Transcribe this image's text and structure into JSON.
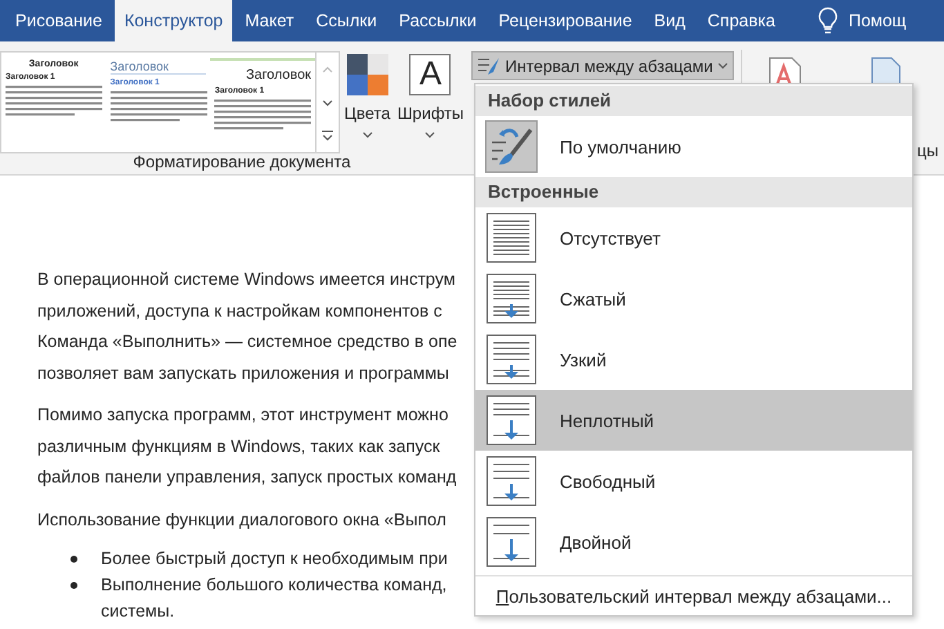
{
  "tabs": [
    {
      "label": "Рисование",
      "selected": false
    },
    {
      "label": "Конструктор",
      "selected": true
    },
    {
      "label": "Макет",
      "selected": false
    },
    {
      "label": "Ссылки",
      "selected": false
    },
    {
      "label": "Рассылки",
      "selected": false
    },
    {
      "label": "Рецензирование",
      "selected": false
    },
    {
      "label": "Вид",
      "selected": false
    },
    {
      "label": "Справка",
      "selected": false
    }
  ],
  "help": {
    "label": "Помощ"
  },
  "ribbon": {
    "styles_gallery": [
      {
        "kind": "basic",
        "title": "Заголовок",
        "subtitle": "Заголовок 1"
      },
      {
        "kind": "lines",
        "title": "Заголовок",
        "subtitle": "Заголовок 1"
      },
      {
        "kind": "elegant",
        "title": "Заголовок",
        "subtitle": "Заголовок 1"
      }
    ],
    "colors_button": {
      "label": "Цвета"
    },
    "fonts_button": {
      "label": "Шрифты",
      "glyph": "A"
    },
    "spacing_button": {
      "label": "Интервал между абзацами",
      "pressed": true
    },
    "group_label": "Форматирование документа",
    "hidden_group_label": "цы"
  },
  "document": {
    "paragraphs": [
      {
        "kind": "text",
        "lines": [
          "В операционной системе Windows имеется инструм",
          "приложений, доступа к настройкам компонентов с",
          "Команда «Выполнить» — системное средство в опе",
          "позволяет вам запускать приложения и программы"
        ]
      },
      {
        "kind": "text",
        "lines": [
          "Помимо запуска программ, этот инструмент можно",
          "различным функциям в Windows, таких как запуск",
          "файлов панели управления, запуск простых команд"
        ]
      },
      {
        "kind": "text",
        "lines": [
          "Использование функции диалогового окна «Выпол"
        ]
      },
      {
        "kind": "bullets",
        "items": [
          [
            "Более быстрый доступ к необходимым при"
          ],
          [
            "Выполнение большого количества команд,",
            "системы."
          ]
        ]
      }
    ]
  },
  "spacing_menu": {
    "sections": [
      {
        "header": "Набор стилей",
        "items": [
          {
            "label": "По умолчанию",
            "kind": "brush",
            "current": true,
            "highlighted": false
          }
        ]
      },
      {
        "header": "Встроенные",
        "items": [
          {
            "label": "Отсутствует",
            "kind": "none",
            "current": false,
            "highlighted": false
          },
          {
            "label": "Сжатый",
            "kind": "compact",
            "current": false,
            "highlighted": false
          },
          {
            "label": "Узкий",
            "kind": "tight",
            "current": false,
            "highlighted": false
          },
          {
            "label": "Неплотный",
            "kind": "open",
            "current": false,
            "highlighted": true
          },
          {
            "label": "Свободный",
            "kind": "relaxed",
            "current": false,
            "highlighted": false
          },
          {
            "label": "Двойной",
            "kind": "double",
            "current": false,
            "highlighted": false
          }
        ]
      }
    ],
    "footer": "Пользовательский интервал между абзацами..."
  }
}
